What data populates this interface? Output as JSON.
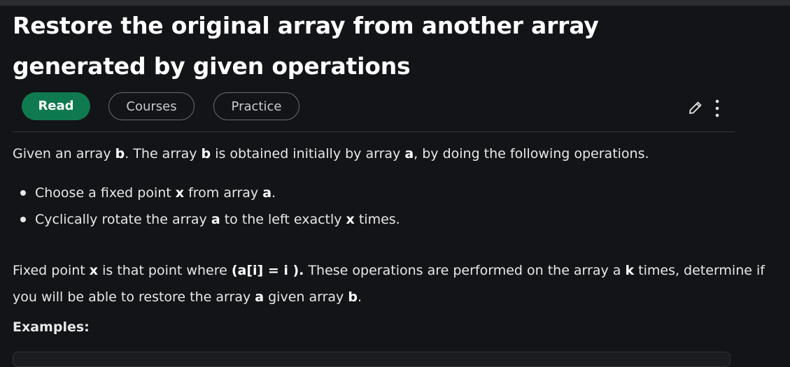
{
  "article": {
    "title": "Restore the original array from another array generated by given operations"
  },
  "tabs": {
    "read": "Read",
    "courses": "Courses",
    "practice": "Practice"
  },
  "actions": {
    "edit_icon": "pencil-icon",
    "more_icon": "vertical-dots-icon"
  },
  "body": {
    "intro": [
      {
        "t": "Given an array "
      },
      {
        "t": "b",
        "b": true
      },
      {
        "t": ". The array "
      },
      {
        "t": "b",
        "b": true
      },
      {
        "t": " is obtained initially by array "
      },
      {
        "t": "a",
        "b": true
      },
      {
        "t": ", by doing the following operations."
      }
    ],
    "operations": [
      [
        {
          "t": "Choose a fixed point "
        },
        {
          "t": "x",
          "b": true
        },
        {
          "t": " from array "
        },
        {
          "t": "a",
          "b": true
        },
        {
          "t": "."
        }
      ],
      [
        {
          "t": "Cyclically rotate the array "
        },
        {
          "t": "a",
          "b": true
        },
        {
          "t": " to the left exactly "
        },
        {
          "t": "x",
          "b": true
        },
        {
          "t": " times."
        }
      ]
    ],
    "fixed_point": [
      {
        "t": "Fixed point "
      },
      {
        "t": "x",
        "b": true
      },
      {
        "t": " is that point where "
      },
      {
        "t": "(a[i] = i ).",
        "b": true
      },
      {
        "t": " These operations are performed on the array a "
      },
      {
        "t": "k",
        "b": true
      },
      {
        "t": " times, determine if you will be able to restore the array "
      },
      {
        "t": "a",
        "b": true
      },
      {
        "t": " given array "
      },
      {
        "t": "b",
        "b": true
      },
      {
        "t": "."
      }
    ],
    "examples_heading": "Examples:"
  },
  "colors": {
    "background": "#131417",
    "accent_green": "#0f7a4f",
    "text": "#e8e8e8"
  }
}
